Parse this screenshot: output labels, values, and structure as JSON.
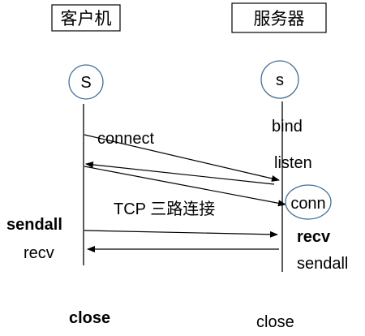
{
  "colors": {
    "line": "#000000",
    "circle": "#41719c",
    "text": "#000000",
    "background": "#ffffff"
  },
  "client": {
    "title": "客户机",
    "socket_label": "S",
    "sendall_label": "sendall",
    "recv_label": "recv",
    "close_label": "close"
  },
  "server": {
    "title": "服务器",
    "socket_label": "s",
    "bind_label": "bind",
    "listen_label": "listen",
    "conn_label": "conn",
    "recv_label": "recv",
    "sendall_label": "sendall",
    "close_label": "close"
  },
  "messages": {
    "connect_label": "connect",
    "handshake_label": "TCP 三路连接"
  }
}
